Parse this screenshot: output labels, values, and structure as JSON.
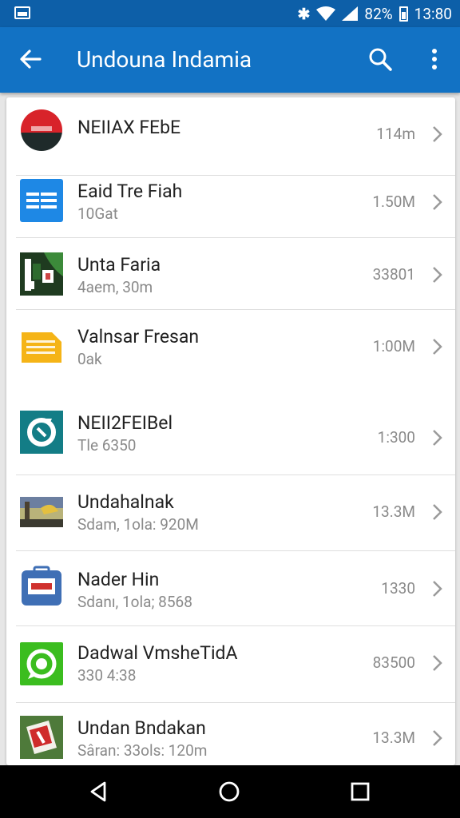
{
  "status_bar": {
    "battery_percent": "82%",
    "time": "13:80"
  },
  "app_bar": {
    "title": "Undouna Indamia"
  },
  "list_items": [
    {
      "title": "NEIIAX FEbE",
      "subtitle": "",
      "size": "114m",
      "icon": "red-black-app-icon"
    },
    {
      "title": "Eaid Tre Fiah",
      "subtitle": "10Gat",
      "size": "1.50M",
      "icon": "blue-lines-app-icon"
    },
    {
      "title": "Unta Faria",
      "subtitle": "4aem, 30m",
      "size": "33801",
      "icon": "forest-scene-app-icon"
    },
    {
      "title": "Valnsar Fresan",
      "subtitle": "0ak",
      "size": "1:00M",
      "icon": "yellow-document-icon"
    },
    {
      "title": "NEII2FEIBel",
      "subtitle": "Tle 6350",
      "size": "1:300",
      "icon": "teal-sync-app-icon"
    },
    {
      "title": "Undahalnak",
      "subtitle": "Sdam, 1ola: 920M",
      "size": "13.3M",
      "icon": "landscape-photo-icon"
    },
    {
      "title": "Nader Hin",
      "subtitle": "Sdanı, 1ola; 8568",
      "size": "1330",
      "icon": "blue-briefcase-icon"
    },
    {
      "title": "Dadwal VmsheTidA",
      "subtitle": "330 4:38",
      "size": "83500",
      "icon": "green-chat-app-icon"
    },
    {
      "title": "Undan Bndakan",
      "subtitle": "Sâran: 33ols: 120m",
      "size": "13.3M",
      "icon": "red-card-photo-icon"
    }
  ],
  "colors": {
    "status_bar": "#0d5fa8",
    "app_bar": "#1272c4",
    "nav_bar": "#000000"
  }
}
